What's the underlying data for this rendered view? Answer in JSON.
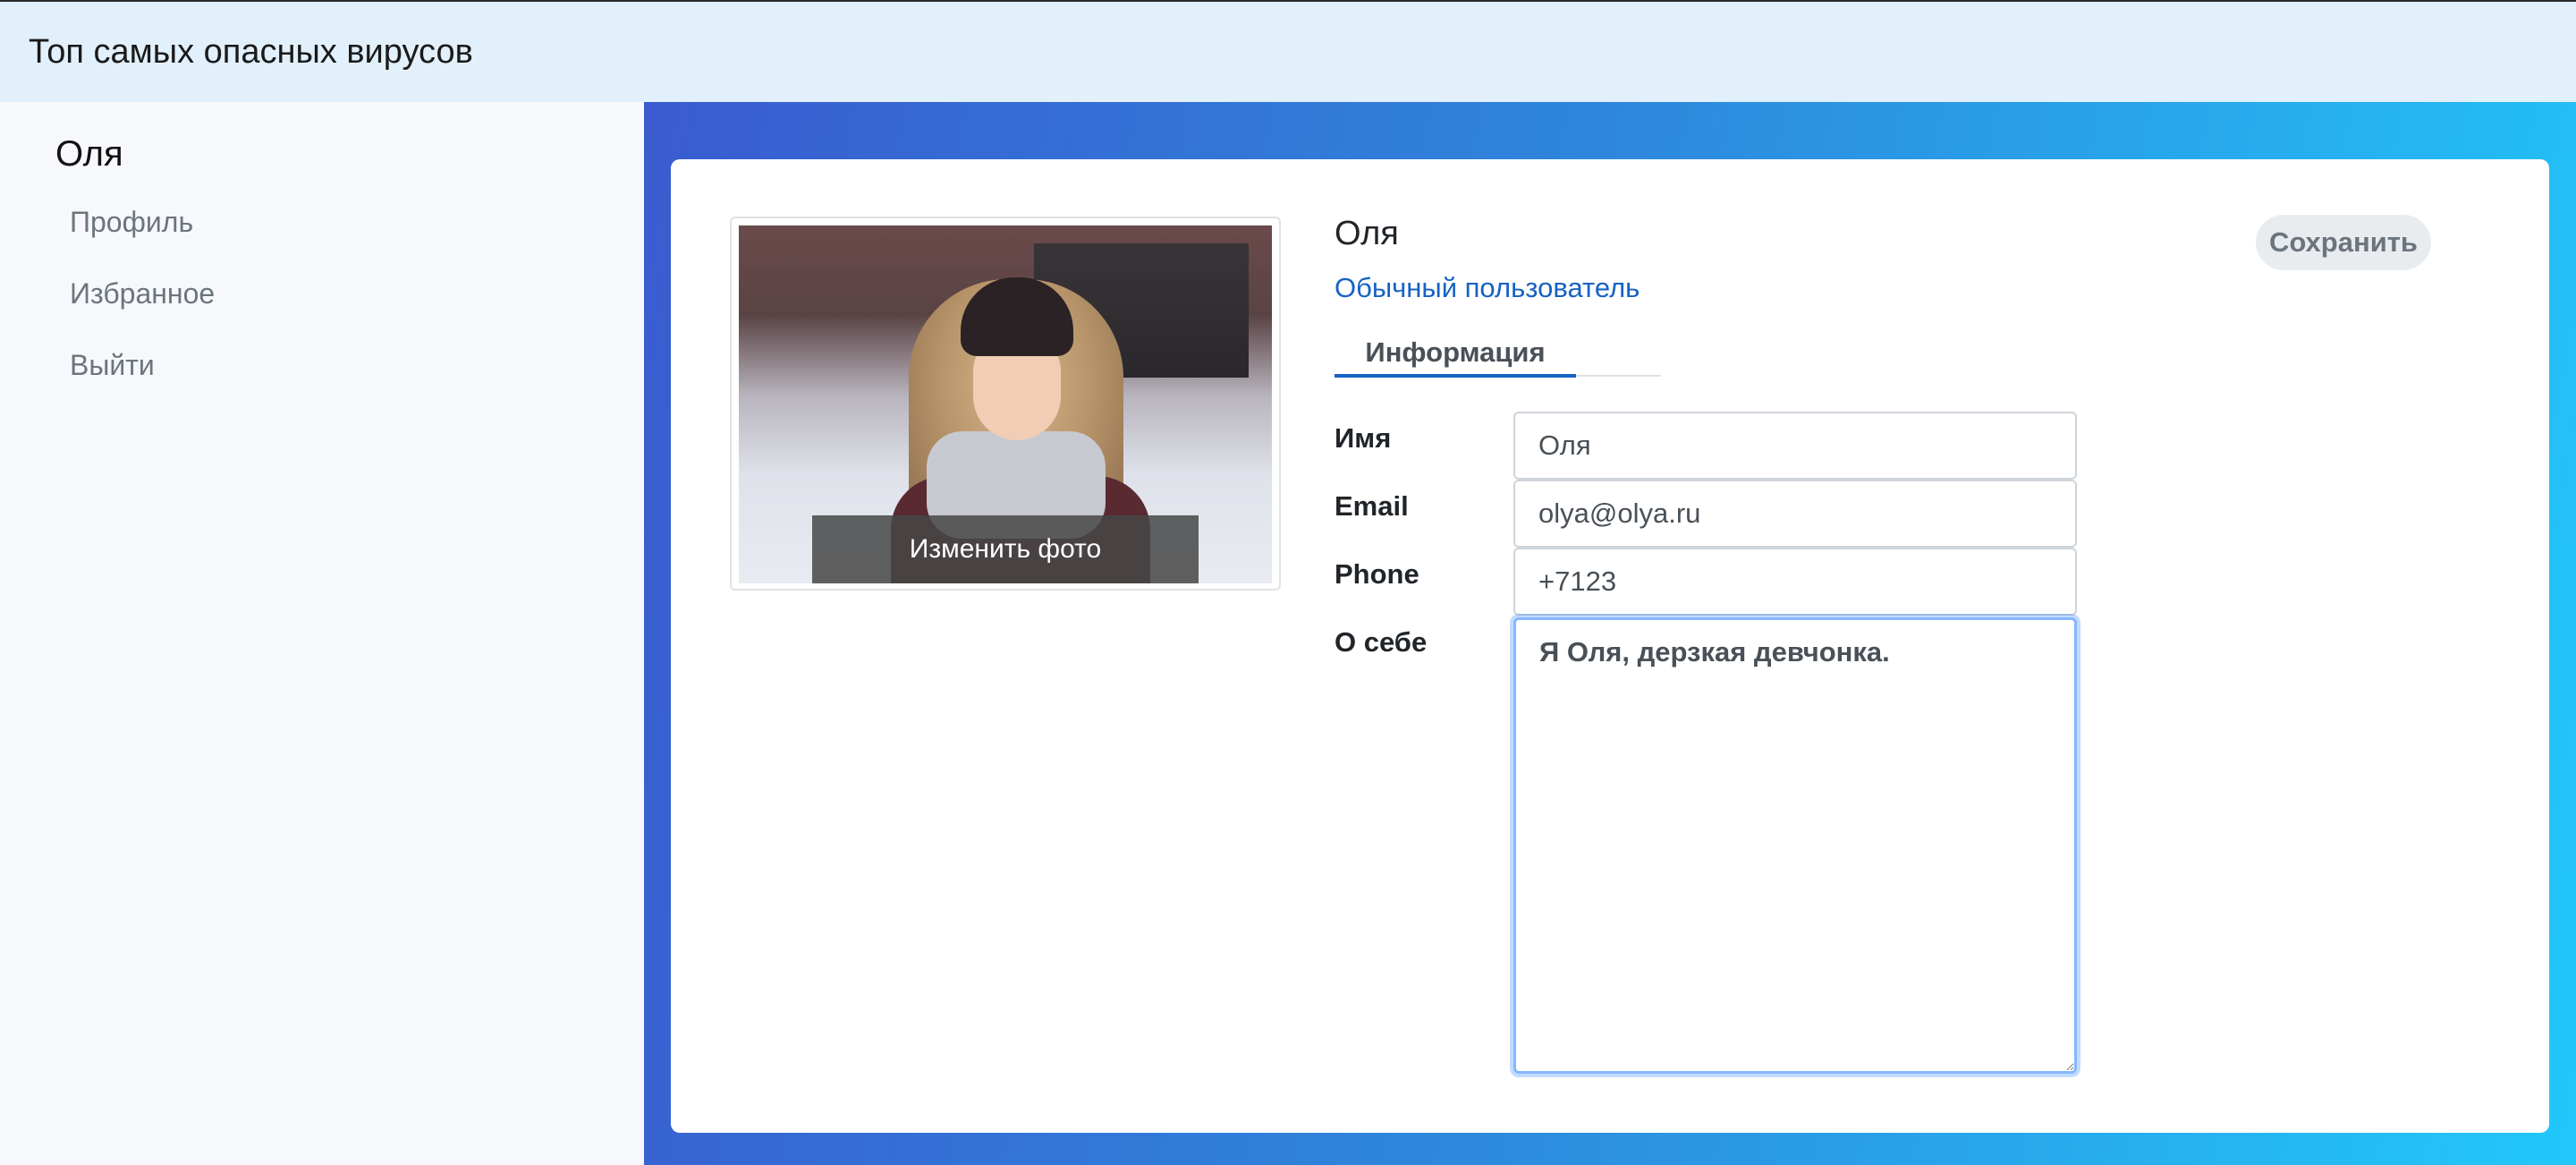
{
  "header": {
    "title": "Топ самых опасных вирусов"
  },
  "sidebar": {
    "user_name": "Оля",
    "items": [
      {
        "label": "Профиль"
      },
      {
        "label": "Избранное"
      },
      {
        "label": "Выйти"
      }
    ]
  },
  "profile": {
    "change_photo_label": "Изменить фото",
    "name": "Оля",
    "role": "Обычный пользователь",
    "save_label": "Сохранить",
    "tabs": [
      {
        "label": "Информация",
        "active": true
      }
    ],
    "fields": {
      "name_label": "Имя",
      "name_value": "Оля",
      "email_label": "Email",
      "email_value": "olya@olya.ru",
      "phone_label": "Phone",
      "phone_value": "+7123",
      "about_label": "О себе",
      "about_value": "Я Оля, дерзкая девчонка."
    }
  },
  "colors": {
    "header_bg": "#e2f0fb",
    "accent": "#1762c4",
    "gradient_start": "#3a5bcf",
    "gradient_end": "#22c8fb"
  }
}
